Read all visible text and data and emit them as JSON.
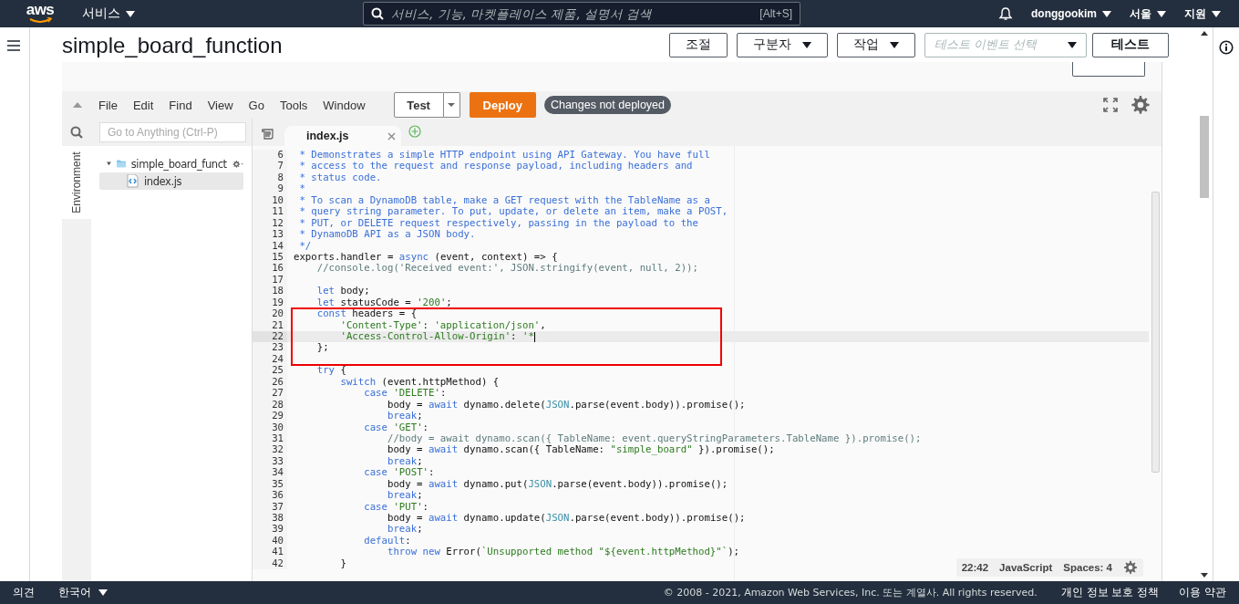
{
  "topbar": {
    "logo": "aws",
    "services": "서비스",
    "search_placeholder": "서비스, 기능, 마켓플레이스 제품, 설명서 검색",
    "shortcut": "[Alt+S]",
    "user": "donggookim",
    "region": "서울",
    "support": "지원"
  },
  "page": {
    "title": "simple_board_function",
    "buttons": [
      {
        "label": "조절",
        "dropdown": false
      },
      {
        "label": "구분자",
        "dropdown": true
      },
      {
        "label": "작업",
        "dropdown": true
      }
    ],
    "event_select_placeholder": "테스트 이벤트 선택",
    "test_button": "테스트"
  },
  "ide": {
    "menu": [
      "File",
      "Edit",
      "Find",
      "View",
      "Go",
      "Tools",
      "Window"
    ],
    "run_button": "Test",
    "deploy_button": "Deploy",
    "status_badge": "Changes not deployed",
    "goto_placeholder": "Go to Anything (Ctrl-P)",
    "side_tab": "Environment",
    "tree": [
      {
        "name": "simple_board_funct",
        "kind": "folder",
        "expanded": true,
        "selected": false,
        "children": [
          {
            "name": "index.js",
            "kind": "file",
            "selected": true
          }
        ]
      }
    ],
    "tabs": [
      {
        "label": "index.js",
        "selected": true
      }
    ],
    "code": [
      {
        "number": "6",
        "tokens": [
          {
            "kind": "doc",
            "text": " * Demonstrates a simple HTTP endpoint using API Gateway. You have full"
          }
        ]
      },
      {
        "number": "7",
        "tokens": [
          {
            "kind": "doc",
            "text": " * access to the request and response payload, including headers and"
          }
        ]
      },
      {
        "number": "8",
        "tokens": [
          {
            "kind": "doc",
            "text": " * status code."
          }
        ]
      },
      {
        "number": "9",
        "tokens": [
          {
            "kind": "doc",
            "text": " *"
          }
        ]
      },
      {
        "number": "10",
        "tokens": [
          {
            "kind": "doc",
            "text": " * To scan a DynamoDB table, make a GET request with the TableName as a"
          }
        ]
      },
      {
        "number": "11",
        "tokens": [
          {
            "kind": "doc",
            "text": " * query string parameter. To put, update, or delete an item, make a POST,"
          }
        ]
      },
      {
        "number": "12",
        "tokens": [
          {
            "kind": "doc",
            "text": " * PUT, or DELETE request respectively, passing in the payload to the"
          }
        ]
      },
      {
        "number": "13",
        "tokens": [
          {
            "kind": "doc",
            "text": " * DynamoDB API as a JSON body."
          }
        ]
      },
      {
        "number": "14",
        "tokens": [
          {
            "kind": "doc",
            "text": " */"
          }
        ]
      },
      {
        "number": "15",
        "tokens": [
          {
            "kind": "plain",
            "text": "exports.handler = "
          },
          {
            "kind": "keyword",
            "text": "async"
          },
          {
            "kind": "plain",
            "text": " (event, context) => {"
          }
        ]
      },
      {
        "number": "16",
        "tokens": [
          {
            "kind": "comment",
            "text": "    //console.log('Received event:', JSON.stringify(event, null, 2));"
          }
        ]
      },
      {
        "number": "17"
      },
      {
        "number": "18",
        "tokens": [
          {
            "kind": "keyword",
            "text": "    let"
          },
          {
            "kind": "plain",
            "text": " body;"
          }
        ]
      },
      {
        "number": "19",
        "tokens": [
          {
            "kind": "keyword",
            "text": "    let"
          },
          {
            "kind": "plain",
            "text": " statusCode = "
          },
          {
            "kind": "string",
            "text": "'200'"
          },
          {
            "kind": "plain",
            "text": ";"
          }
        ]
      },
      {
        "number": "20",
        "annotated": true,
        "tokens": [
          {
            "kind": "keyword",
            "text": "    const"
          },
          {
            "kind": "plain",
            "text": " headers = {"
          }
        ]
      },
      {
        "number": "21",
        "annotated": true,
        "tokens": [
          {
            "kind": "string",
            "text": "        'Content-Type'"
          },
          {
            "kind": "plain",
            "text": ": "
          },
          {
            "kind": "string",
            "text": "'application/json'"
          },
          {
            "kind": "plain",
            "text": ","
          }
        ]
      },
      {
        "number": "22",
        "annotated": true,
        "current": true,
        "tokens": [
          {
            "kind": "string",
            "text": "        'Access-Control-Allow-Origin'"
          },
          {
            "kind": "plain",
            "text": ": "
          },
          {
            "kind": "string",
            "text": "'*"
          }
        ]
      },
      {
        "number": "23",
        "annotated": true,
        "tokens": [
          {
            "kind": "plain",
            "text": "    };"
          }
        ]
      },
      {
        "number": "24",
        "annotated": true
      },
      {
        "number": "25",
        "tokens": [
          {
            "kind": "keyword",
            "text": "    try"
          },
          {
            "kind": "plain",
            "text": " {"
          }
        ]
      },
      {
        "number": "26",
        "tokens": [
          {
            "kind": "keyword",
            "text": "        switch"
          },
          {
            "kind": "plain",
            "text": " (event.httpMethod) {"
          }
        ]
      },
      {
        "number": "27",
        "tokens": [
          {
            "kind": "keyword",
            "text": "            case"
          },
          {
            "kind": "string",
            "text": " 'DELETE'"
          },
          {
            "kind": "plain",
            "text": ":"
          }
        ]
      },
      {
        "number": "28",
        "tokens": [
          {
            "kind": "plain",
            "text": "                body = "
          },
          {
            "kind": "keyword",
            "text": "await"
          },
          {
            "kind": "plain",
            "text": " dynamo.delete("
          },
          {
            "kind": "builtin",
            "text": "JSON"
          },
          {
            "kind": "plain",
            "text": ".parse(event.body)).promise();"
          }
        ]
      },
      {
        "number": "29",
        "tokens": [
          {
            "kind": "keyword",
            "text": "                break"
          },
          {
            "kind": "plain",
            "text": ";"
          }
        ]
      },
      {
        "number": "30",
        "tokens": [
          {
            "kind": "keyword",
            "text": "            case"
          },
          {
            "kind": "string",
            "text": " 'GET'"
          },
          {
            "kind": "plain",
            "text": ":"
          }
        ]
      },
      {
        "number": "31",
        "tokens": [
          {
            "kind": "comment",
            "text": "                //body = await dynamo.scan({ TableName: event.queryStringParameters.TableName }).promise();"
          }
        ]
      },
      {
        "number": "32",
        "tokens": [
          {
            "kind": "plain",
            "text": "                body = "
          },
          {
            "kind": "keyword",
            "text": "await"
          },
          {
            "kind": "plain",
            "text": " dynamo.scan({ TableName: "
          },
          {
            "kind": "string",
            "text": "\"simple_board\""
          },
          {
            "kind": "plain",
            "text": " }).promise();"
          }
        ]
      },
      {
        "number": "33",
        "tokens": [
          {
            "kind": "keyword",
            "text": "                break"
          },
          {
            "kind": "plain",
            "text": ";"
          }
        ]
      },
      {
        "number": "34",
        "tokens": [
          {
            "kind": "keyword",
            "text": "            case"
          },
          {
            "kind": "string",
            "text": " 'POST'"
          },
          {
            "kind": "plain",
            "text": ":"
          }
        ]
      },
      {
        "number": "35",
        "tokens": [
          {
            "kind": "plain",
            "text": "                body = "
          },
          {
            "kind": "keyword",
            "text": "await"
          },
          {
            "kind": "plain",
            "text": " dynamo.put("
          },
          {
            "kind": "builtin",
            "text": "JSON"
          },
          {
            "kind": "plain",
            "text": ".parse(event.body)).promise();"
          }
        ]
      },
      {
        "number": "36",
        "tokens": [
          {
            "kind": "keyword",
            "text": "                break"
          },
          {
            "kind": "plain",
            "text": ";"
          }
        ]
      },
      {
        "number": "37",
        "tokens": [
          {
            "kind": "keyword",
            "text": "            case"
          },
          {
            "kind": "string",
            "text": " 'PUT'"
          },
          {
            "kind": "plain",
            "text": ":"
          }
        ]
      },
      {
        "number": "38",
        "tokens": [
          {
            "kind": "plain",
            "text": "                body = "
          },
          {
            "kind": "keyword",
            "text": "await"
          },
          {
            "kind": "plain",
            "text": " dynamo.update("
          },
          {
            "kind": "builtin",
            "text": "JSON"
          },
          {
            "kind": "plain",
            "text": ".parse(event.body)).promise();"
          }
        ]
      },
      {
        "number": "39",
        "tokens": [
          {
            "kind": "keyword",
            "text": "                break"
          },
          {
            "kind": "plain",
            "text": ";"
          }
        ]
      },
      {
        "number": "40",
        "tokens": [
          {
            "kind": "keyword",
            "text": "            default"
          },
          {
            "kind": "plain",
            "text": ":"
          }
        ]
      },
      {
        "number": "41",
        "tokens": [
          {
            "kind": "keyword",
            "text": "                throw"
          },
          {
            "kind": "keyword",
            "text": " new"
          },
          {
            "kind": "plain",
            "text": " Error("
          },
          {
            "kind": "string",
            "text": "`Unsupported method \"${event.httpMethod}\"`"
          },
          {
            "kind": "plain",
            "text": ");"
          }
        ]
      },
      {
        "number": "42",
        "tokens": [
          {
            "kind": "plain",
            "text": "        }"
          }
        ]
      }
    ],
    "status": {
      "position": "22:42",
      "language": "JavaScript",
      "spaces": "Spaces: 4"
    }
  },
  "footer": {
    "feedback": "의견",
    "language": "한국어",
    "copyright": "© 2008 - 2021, Amazon Web Services, Inc. 또는 계열사. All rights reserved.",
    "links": [
      "개인 정보 보호 정책",
      "이용 약관"
    ]
  }
}
